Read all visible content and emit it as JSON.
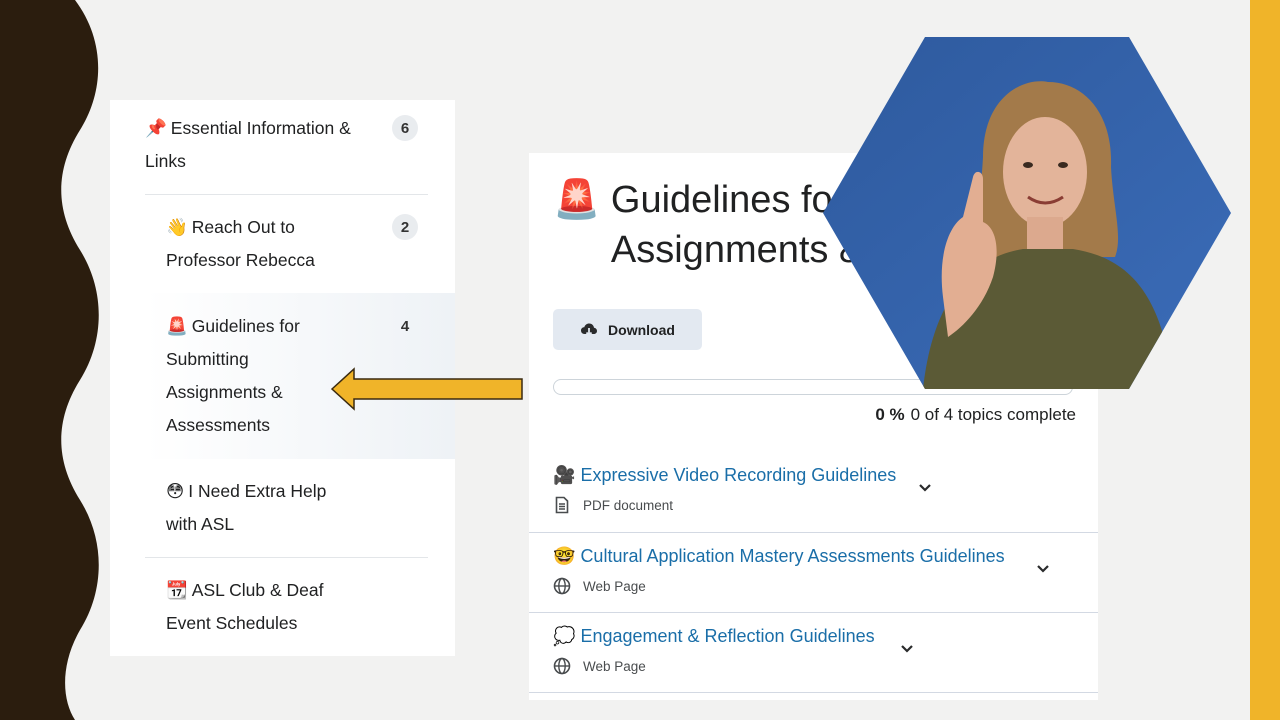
{
  "sidebar": {
    "items": [
      {
        "emoji": "📌",
        "label": "Essential Information & Links",
        "count": "6"
      },
      {
        "emoji": "👋",
        "label": "Reach Out to Professor Rebecca",
        "count": "2"
      },
      {
        "emoji": "🚨",
        "label": "Guidelines for Submitting Assignments & Assessments",
        "count": "4"
      },
      {
        "emoji": "😳",
        "label": "I Need Extra Help with ASL"
      },
      {
        "emoji": "📆",
        "label": "ASL Club & Deaf Event Schedules"
      }
    ],
    "selected_index": 2
  },
  "content": {
    "title_emoji": "🚨",
    "title": "Guidelines for Submitting Assignments & Assessments",
    "download_label": "Download",
    "progress": {
      "fraction": 0,
      "percent_label": "0 %",
      "status_text": "0 of 4 topics complete"
    },
    "topics": [
      {
        "emoji": "🎥",
        "title": "Expressive Video Recording Guidelines",
        "type": "PDF document",
        "icon": "document-icon"
      },
      {
        "emoji": "🤓",
        "title": "Cultural Application Mastery Assessments Guidelines",
        "type": "Web Page",
        "icon": "globe-icon"
      },
      {
        "emoji": "💭",
        "title": "Engagement & Reflection Guidelines",
        "type": "Web Page",
        "icon": "globe-icon"
      }
    ]
  },
  "colors": {
    "accent_yellow": "#f0b429",
    "frame_dark": "#2b1d0e",
    "link_blue": "#1a6ea8",
    "hex_background": "#2f5fa6"
  }
}
